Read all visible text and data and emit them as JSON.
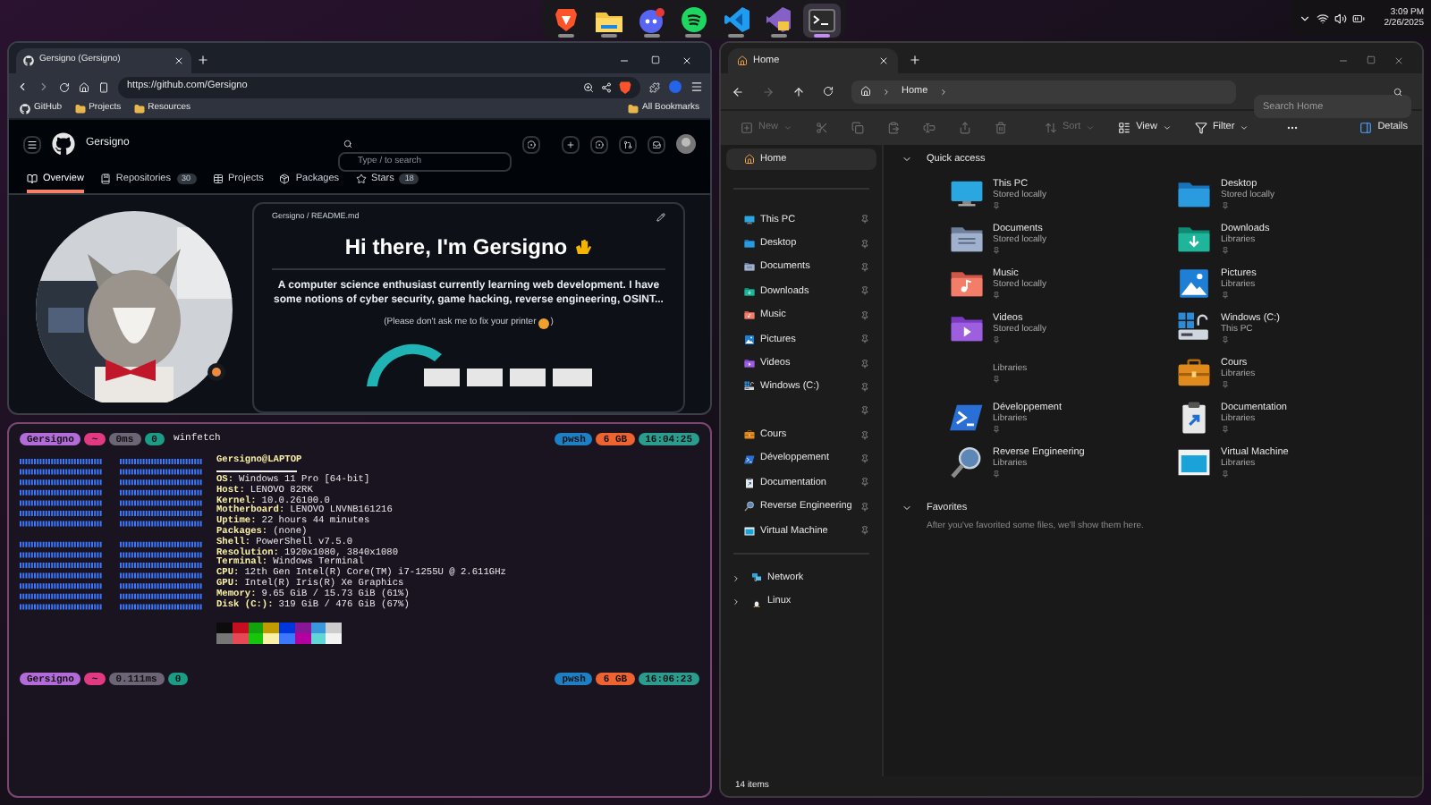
{
  "taskbar": {
    "apps": [
      {
        "kind": "brave",
        "selected": false
      },
      {
        "kind": "files",
        "selected": false
      },
      {
        "kind": "discord",
        "selected": false
      },
      {
        "kind": "spotify",
        "selected": false
      },
      {
        "kind": "vscode",
        "selected": false
      },
      {
        "kind": "studio",
        "selected": false
      },
      {
        "kind": "terminal",
        "selected": true
      }
    ]
  },
  "tray": {
    "time": "3:09 PM",
    "date": "2/26/2025"
  },
  "browser": {
    "tabs": [
      {
        "title": "Gersigno (Gersigno)",
        "selected": true
      }
    ],
    "url": "https://github.com/Gersigno",
    "bookmarks": [
      {
        "kind": "github",
        "label": "GitHub"
      },
      {
        "kind": "folder",
        "label": "Projects"
      },
      {
        "kind": "folder",
        "label": "Resources"
      }
    ],
    "all_bookmarks": "All Bookmarks",
    "github": {
      "username": "Gersigno",
      "search": {
        "placeholder": "Type / to search"
      },
      "tabs": [
        {
          "kind": "book",
          "label": "Overview",
          "selected": true
        },
        {
          "kind": "repo",
          "label": "Repositories",
          "count": "30",
          "selected": false
        },
        {
          "kind": "table",
          "label": "Projects",
          "selected": false
        },
        {
          "kind": "package",
          "label": "Packages",
          "selected": false
        },
        {
          "kind": "star",
          "label": "Stars",
          "count": "18",
          "selected": false
        }
      ],
      "readme": {
        "path": "Gersigno / README.md",
        "heading": "Hi there, I'm Gersigno",
        "body": "A computer science enthusiast currently learning web development. I have some notions of cyber security, game hacking, reverse engineering, OSINT...",
        "note": "(Please don't ask me to fix your printer",
        "note_end": ")"
      }
    }
  },
  "terminal": {
    "prompts": [
      {
        "segments": [
          {
            "text": "Gersigno",
            "color": "#b36bd9"
          },
          {
            "text": "~",
            "color": "#e23a82"
          },
          {
            "text": "0ms",
            "color": "#6b6576"
          },
          {
            "text": "0",
            "color": "#1a9c86"
          }
        ],
        "command": "winfetch",
        "right": [
          {
            "text": "pwsh",
            "color": "#1d7fc4"
          },
          {
            "text": "6 GB",
            "color": "#ef6331"
          },
          {
            "text": "16:04:25",
            "color": "#2a9d8f"
          }
        ]
      },
      {
        "segments": [
          {
            "text": "Gersigno",
            "color": "#b36bd9"
          },
          {
            "text": "~",
            "color": "#e23a82"
          },
          {
            "text": "0.111ms",
            "color": "#6b6576"
          },
          {
            "text": "0",
            "color": "#1a9c86"
          }
        ],
        "right": [
          {
            "text": "pwsh",
            "color": "#1d7fc4"
          },
          {
            "text": "6 GB",
            "color": "#ef6331"
          },
          {
            "text": "16:06:23",
            "color": "#2a9d8f"
          }
        ]
      }
    ],
    "fetch": {
      "title": "Gersigno@LAPTOP",
      "lines": [
        {
          "key": "OS:",
          "value": "Windows 11 Pro [64-bit]"
        },
        {
          "key": "Host:",
          "value": "LENOVO 82RK"
        },
        {
          "key": "Kernel:",
          "value": "10.0.26100.0"
        },
        {
          "key": "Motherboard:",
          "value": "LENOVO LNVNB161216"
        },
        {
          "key": "Uptime:",
          "value": "22 hours 44 minutes"
        },
        {
          "key": "Packages:",
          "value": "(none)"
        },
        {
          "key": "Shell:",
          "value": "PowerShell v7.5.0"
        },
        {
          "key": "Resolution:",
          "value": "1920x1080, 3840x1080"
        },
        {
          "key": "Terminal:",
          "value": "Windows Terminal"
        },
        {
          "key": "CPU:",
          "value": "12th Gen Intel(R) Core(TM) i7-1255U @ 2.611GHz"
        },
        {
          "key": "GPU:",
          "value": "Intel(R) Iris(R) Xe Graphics"
        },
        {
          "key": "Memory:",
          "value": "9.65 GiB / 15.73 GiB (61%)"
        },
        {
          "key": "Disk (C:):",
          "value": "319 GiB / 476 GiB (67%)"
        }
      ],
      "palette": [
        {
          "color": "#0c0c0c"
        },
        {
          "color": "#c50f1f"
        },
        {
          "color": "#13a10e"
        },
        {
          "color": "#c19c00"
        },
        {
          "color": "#0037da"
        },
        {
          "color": "#881798"
        },
        {
          "color": "#3a96dd"
        },
        {
          "color": "#cccccc"
        },
        {
          "color": "#767676"
        },
        {
          "color": "#e74856"
        },
        {
          "color": "#16c60c"
        },
        {
          "color": "#f9f1a5"
        },
        {
          "color": "#3b78ff"
        },
        {
          "color": "#b4009e"
        },
        {
          "color": "#61d6d6"
        },
        {
          "color": "#f2f2f2"
        }
      ]
    }
  },
  "explorer": {
    "tabs": [
      {
        "title": "Home",
        "selected": true
      }
    ],
    "breadcrumb": [
      "Home"
    ],
    "search": {
      "placeholder": "Search Home"
    },
    "commands": [
      {
        "kind": "new",
        "label": "New",
        "disabled": true
      },
      {
        "kind": "cut",
        "disabled": true
      },
      {
        "kind": "copy",
        "disabled": true
      },
      {
        "kind": "paste",
        "disabled": true
      },
      {
        "kind": "rename",
        "disabled": true
      },
      {
        "kind": "share",
        "disabled": true
      },
      {
        "kind": "delete",
        "disabled": true
      },
      {
        "kind": "sort",
        "label": "Sort",
        "disabled": true
      },
      {
        "kind": "view",
        "label": "View",
        "disabled": false
      },
      {
        "kind": "filter",
        "label": "Filter",
        "disabled": false
      },
      {
        "kind": "more",
        "disabled": false
      }
    ],
    "details": "Details",
    "sidebar": {
      "home": {
        "label": "Home",
        "selected": true
      },
      "pinned": [
        {
          "kind": "pc",
          "label": "This PC",
          "selected": false
        },
        {
          "kind": "desktop",
          "label": "Desktop",
          "selected": false
        },
        {
          "kind": "documents",
          "label": "Documents",
          "selected": false
        },
        {
          "kind": "downloads",
          "label": "Downloads",
          "selected": false
        },
        {
          "kind": "music",
          "label": "Music",
          "selected": false
        },
        {
          "kind": "pictures",
          "label": "Pictures",
          "selected": false
        },
        {
          "kind": "videos",
          "label": "Videos",
          "selected": false
        },
        {
          "kind": "drive",
          "label": "Windows (C:)",
          "selected": false
        },
        {
          "kind": "blank",
          "selected": false
        },
        {
          "kind": "briefcase",
          "label": "Cours",
          "selected": false
        },
        {
          "kind": "powershell",
          "label": "Développement",
          "selected": false
        },
        {
          "kind": "clipboard",
          "label": "Documentation",
          "selected": false
        },
        {
          "kind": "magnifier",
          "label": "Reverse Engineering",
          "selected": false
        },
        {
          "kind": "window",
          "label": "Virtual Machine",
          "selected": false
        }
      ],
      "locations": [
        {
          "kind": "network",
          "label": "Network",
          "expanded": false
        },
        {
          "kind": "linux",
          "label": "Linux",
          "expanded": false
        }
      ]
    },
    "quick_access": {
      "title": "Quick access",
      "expanded": true,
      "items": [
        {
          "kind": "pc",
          "name": "This PC",
          "location": "Stored locally"
        },
        {
          "kind": "desktop",
          "name": "Desktop",
          "location": "Stored locally"
        },
        {
          "kind": "documents",
          "name": "Documents",
          "location": "Stored locally"
        },
        {
          "kind": "downloads",
          "name": "Downloads",
          "location": "Libraries"
        },
        {
          "kind": "music",
          "name": "Music",
          "location": "Stored locally"
        },
        {
          "kind": "pictures",
          "name": "Pictures",
          "location": "Libraries"
        },
        {
          "kind": "videos",
          "name": "Videos",
          "location": "Stored locally"
        },
        {
          "kind": "drive",
          "name": "Windows (C:)",
          "location": "This PC"
        },
        {
          "kind": "blank",
          "location": "Libraries"
        },
        {
          "kind": "briefcase",
          "name": "Cours",
          "location": "Libraries"
        },
        {
          "kind": "powershell",
          "name": "Développement",
          "location": "Libraries"
        },
        {
          "kind": "clipboard",
          "name": "Documentation",
          "location": "Libraries"
        },
        {
          "kind": "magnifier",
          "name": "Reverse Engineering",
          "location": "Libraries"
        },
        {
          "kind": "window",
          "name": "Virtual Machine",
          "location": "Libraries"
        }
      ]
    },
    "favorites": {
      "title": "Favorites",
      "expanded": true,
      "empty_text": "After you've favorited some files, we'll show them here."
    },
    "status": "14 items"
  }
}
